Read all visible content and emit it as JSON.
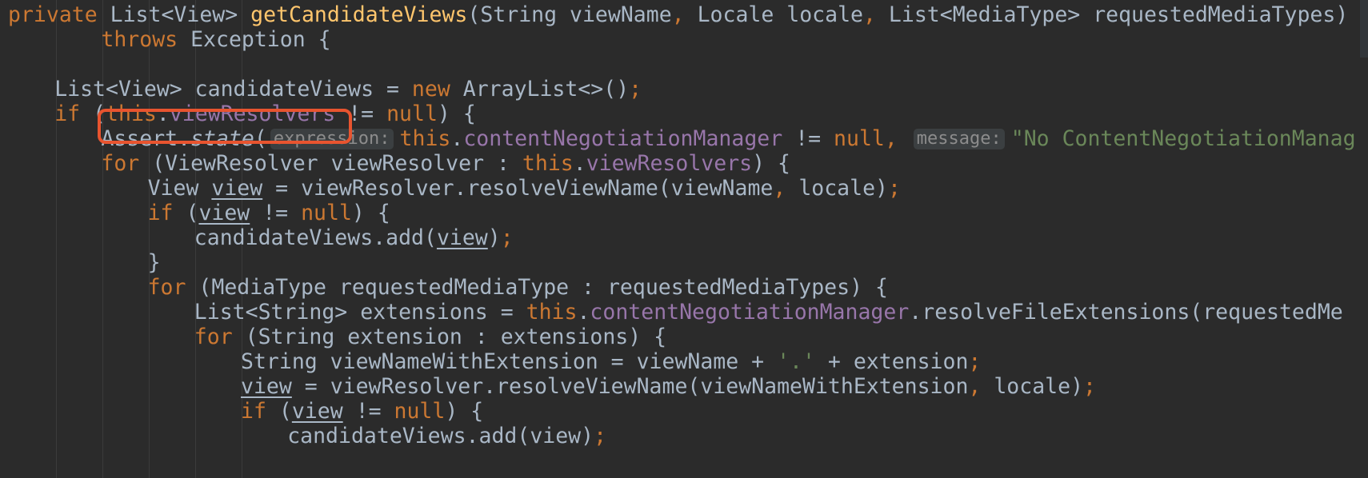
{
  "editor": {
    "lines": [
      {
        "indent": 0,
        "tokens": [
          {
            "t": "private ",
            "c": "kw"
          },
          {
            "t": "List<View> "
          },
          {
            "t": "getCandidateViews",
            "c": "fn"
          },
          {
            "t": "(String viewName"
          },
          {
            "t": ", ",
            "c": "kw"
          },
          {
            "t": "Locale locale"
          },
          {
            "t": ", ",
            "c": "kw"
          },
          {
            "t": "List<MediaType> requestedMediaTypes)"
          }
        ]
      },
      {
        "indent": 8,
        "tokens": [
          {
            "t": "throws ",
            "c": "kw"
          },
          {
            "t": "Exception {"
          }
        ]
      },
      {
        "indent": 0,
        "tokens": []
      },
      {
        "indent": 4,
        "tokens": [
          {
            "t": "List<View> candidateViews = "
          },
          {
            "t": "new ",
            "c": "kw"
          },
          {
            "t": "ArrayList<>()"
          },
          {
            "t": ";",
            "c": "kw"
          }
        ]
      },
      {
        "indent": 4,
        "tokens": [
          {
            "t": "if ",
            "c": "kw"
          },
          {
            "t": "("
          },
          {
            "t": "this",
            "c": "kw"
          },
          {
            "t": "."
          },
          {
            "t": "viewResolvers ",
            "c": "field"
          },
          {
            "t": "!= "
          },
          {
            "t": "null",
            "c": "kw"
          },
          {
            "t": ") {"
          }
        ]
      },
      {
        "indent": 8,
        "tokens": [
          {
            "t": "Assert."
          },
          {
            "t": "state",
            "c": "ital"
          },
          {
            "t": "("
          },
          {
            "t": "expression:",
            "c": "hint"
          },
          {
            "t": "this",
            "c": "kw"
          },
          {
            "t": "."
          },
          {
            "t": "contentNegotiationManager ",
            "c": "field"
          },
          {
            "t": "!= "
          },
          {
            "t": "null",
            "c": "kw"
          },
          {
            "t": ", ",
            "c": "kw"
          },
          {
            "t": "message:",
            "c": "hint"
          },
          {
            "t": "\"No ContentNegotiationManag",
            "c": "str"
          }
        ]
      },
      {
        "indent": 8,
        "tokens": [
          {
            "t": "for ",
            "c": "kw"
          },
          {
            "t": "(ViewResolver viewResolver : "
          },
          {
            "t": "this",
            "c": "kw"
          },
          {
            "t": "."
          },
          {
            "t": "viewResolvers",
            "c": "field"
          },
          {
            "t": ") {"
          }
        ]
      },
      {
        "indent": 12,
        "tokens": [
          {
            "t": "View "
          },
          {
            "t": "view",
            "c": "u"
          },
          {
            "t": " = viewResolver.resolveViewName(viewName"
          },
          {
            "t": ", ",
            "c": "kw"
          },
          {
            "t": "locale)"
          },
          {
            "t": ";",
            "c": "kw"
          }
        ]
      },
      {
        "indent": 12,
        "tokens": [
          {
            "t": "if ",
            "c": "kw"
          },
          {
            "t": "("
          },
          {
            "t": "view",
            "c": "u"
          },
          {
            "t": " != "
          },
          {
            "t": "null",
            "c": "kw"
          },
          {
            "t": ") {"
          }
        ]
      },
      {
        "indent": 16,
        "tokens": [
          {
            "t": "candidateViews.add("
          },
          {
            "t": "view",
            "c": "u"
          },
          {
            "t": ")"
          },
          {
            "t": ";",
            "c": "kw"
          }
        ]
      },
      {
        "indent": 12,
        "tokens": [
          {
            "t": "}"
          }
        ]
      },
      {
        "indent": 12,
        "tokens": [
          {
            "t": "for ",
            "c": "kw"
          },
          {
            "t": "(MediaType requestedMediaType : requestedMediaTypes) {"
          }
        ]
      },
      {
        "indent": 16,
        "tokens": [
          {
            "t": "List<String> extensions = "
          },
          {
            "t": "this",
            "c": "kw"
          },
          {
            "t": "."
          },
          {
            "t": "contentNegotiationManager",
            "c": "field"
          },
          {
            "t": ".resolveFileExtensions(requestedMe"
          }
        ]
      },
      {
        "indent": 16,
        "tokens": [
          {
            "t": "for ",
            "c": "kw"
          },
          {
            "t": "(String extension : extensions) {"
          }
        ]
      },
      {
        "indent": 20,
        "tokens": [
          {
            "t": "String viewNameWithExtension = viewName + "
          },
          {
            "t": "'.'",
            "c": "str"
          },
          {
            "t": " + extension"
          },
          {
            "t": ";",
            "c": "kw"
          }
        ]
      },
      {
        "indent": 20,
        "tokens": [
          {
            "t": "view",
            "c": "u"
          },
          {
            "t": " = viewResolver.resolveViewName(viewNameWithExtension"
          },
          {
            "t": ", ",
            "c": "kw"
          },
          {
            "t": "locale)"
          },
          {
            "t": ";",
            "c": "kw"
          }
        ]
      },
      {
        "indent": 20,
        "tokens": [
          {
            "t": "if ",
            "c": "kw"
          },
          {
            "t": "("
          },
          {
            "t": "view",
            "c": "u"
          },
          {
            "t": " != "
          },
          {
            "t": "null",
            "c": "kw"
          },
          {
            "t": ") {"
          }
        ]
      },
      {
        "indent": 24,
        "tokens": [
          {
            "t": "candidateViews.add(view)"
          },
          {
            "t": ";",
            "c": "kw"
          }
        ]
      }
    ]
  },
  "highlight": {
    "label": "this.viewResolvers",
    "color": "#e8542f"
  },
  "colors": {
    "background": "#2b2b2b",
    "text": "#a9b7c6",
    "keyword": "#cc7832",
    "method": "#ffc66d",
    "field": "#9876aa",
    "string": "#6a8759",
    "hint_bg": "#3b3f41",
    "hint_text": "#8c8c8c"
  }
}
